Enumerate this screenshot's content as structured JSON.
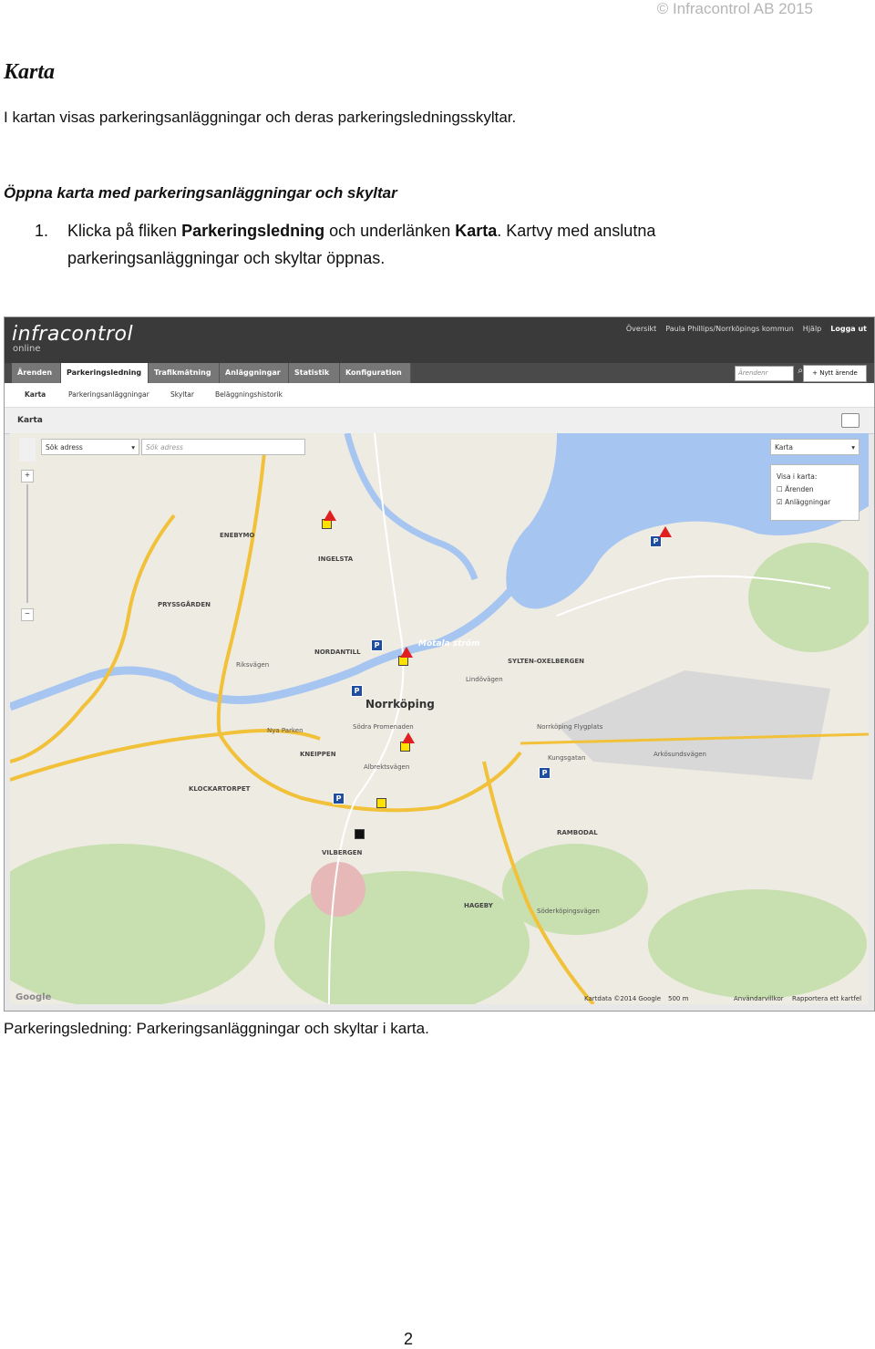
{
  "header": {
    "copyright": "© Infracontrol AB 2015"
  },
  "doc": {
    "title": "Karta",
    "intro": "I kartan visas parkeringsanläggningar och deras parkeringsledningsskyltar.",
    "subheading": "Öppna karta med parkeringsanläggningar och skyltar",
    "step_num": "1.",
    "step_text_1": "Klicka på fliken ",
    "step_bold_1": "Parkeringsledning",
    "step_text_2": " och underlänken ",
    "step_bold_2": "Karta",
    "step_text_3": ". Kartvy med anslutna parkeringsanläggningar och skyltar öppnas.",
    "caption": "Parkeringsledning: Parkeringsanläggningar och skyltar i karta.",
    "page_number": "2"
  },
  "app": {
    "logo": "infracontrol",
    "logo_sub": "online",
    "topnav": [
      "Översikt",
      "Paula Phillips/Norrköpings kommun",
      "Hjälp",
      "Logga ut"
    ],
    "tabs": [
      "Ärenden",
      "Parkeringsledning",
      "Trafikmätning",
      "Anläggningar",
      "Statistik",
      "Konfiguration"
    ],
    "active_tab": "Parkeringsledning",
    "search_placeholder": "Ärendenr",
    "new_case": "Nytt ärende",
    "subtabs": [
      "Karta",
      "Parkeringsanläggningar",
      "Skyltar",
      "Beläggningshistorik"
    ],
    "panel_title": "Karta"
  },
  "map": {
    "addr_select": "Sök adress",
    "addr_placeholder": "Sök adress",
    "map_type": "Karta",
    "show_title": "Visa i karta:",
    "show_options": [
      {
        "label": "Ärenden",
        "checked": false
      },
      {
        "label": "Anläggningar",
        "checked": true
      }
    ],
    "places": {
      "norrkoping": "Norrköping",
      "motala": "Motala ström",
      "enebymo": "ENEBYMO",
      "ingelsta": "INGELSTA",
      "pryssgarden": "PRYSSGÅRDEN",
      "nordantill": "NORDANTILL",
      "sylten": "SYLTEN-OXELBERGEN",
      "nyaparken": "Nya Parken",
      "kneippen": "KNEIPPEN",
      "klockartorpet": "KLOCKARTORPET",
      "vilbergen": "VILBERGEN",
      "hageby": "HAGEBY",
      "rambodal": "RAMBODAL",
      "flygplats": "Norrköping Flygplats",
      "sodra": "Södra Promenaden",
      "albrekts": "Albrektsvägen",
      "lindovagen": "Lindövägen",
      "arkosund": "Arkösundsvägen",
      "soderkoping": "Söderköpingsvägen",
      "riksvagen": "Riksvägen",
      "kungsgatan": "Kungsgatan",
      "hagebyvagen": "Hagebygatan"
    },
    "footer": {
      "google": "Google",
      "copyright": "Kartdata ©2014 Google",
      "scale": "500 m",
      "terms": "Användarvillkor",
      "report": "Rapportera ett kartfel"
    }
  },
  "colors": {
    "water": "#a6c5f0",
    "park": "#c8e0b0",
    "road_major": "#f2c13a",
    "road_minor": "#ffffff",
    "tab_active": "#ffffff",
    "topbar": "#3a3a3a"
  }
}
